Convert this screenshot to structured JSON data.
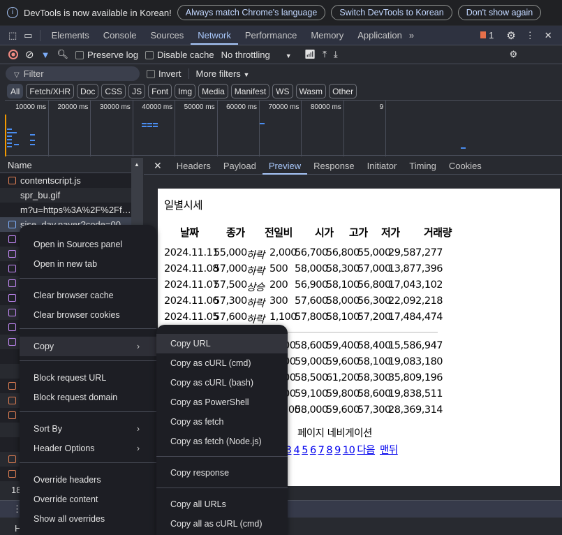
{
  "infobar": {
    "message": "DevTools is now available in Korean!",
    "buttons": [
      "Always match Chrome's language",
      "Switch DevTools to Korean",
      "Don't show again"
    ]
  },
  "tabs": [
    "Elements",
    "Console",
    "Sources",
    "Network",
    "Performance",
    "Memory",
    "Application"
  ],
  "active_tab": "Network",
  "issues_count": "1",
  "toolbar": {
    "preserve_log": "Preserve log",
    "disable_cache": "Disable cache",
    "throttling": "No throttling"
  },
  "filter": {
    "placeholder": "Filter",
    "invert": "Invert",
    "more_filters": "More filters"
  },
  "type_chips": [
    "All",
    "Fetch/XHR",
    "Doc",
    "CSS",
    "JS",
    "Font",
    "Img",
    "Media",
    "Manifest",
    "WS",
    "Wasm",
    "Other"
  ],
  "timeline_ticks": [
    "10000 ms",
    "20000 ms",
    "30000 ms",
    "40000 ms",
    "50000 ms",
    "60000 ms",
    "70000 ms",
    "80000 ms",
    "9"
  ],
  "request_list": {
    "header": "Name",
    "items": [
      "contentscript.js",
      "spr_bu.gif",
      "m?u=https%3A%2F%2Ffina...",
      "sise_day.naver?code=0059..."
    ],
    "footer_count": "18",
    "bottom_letter": "H"
  },
  "detail_tabs": [
    "Headers",
    "Payload",
    "Preview",
    "Response",
    "Initiator",
    "Timing",
    "Cookies"
  ],
  "active_detail_tab": "Preview",
  "preview": {
    "title": "일별시세",
    "headers": [
      "날짜",
      "종가",
      "전일비",
      "시가",
      "고가",
      "저가",
      "거래량"
    ],
    "rows": [
      [
        "2024.11.11",
        "55,000",
        "하락",
        "2,000",
        "56,700",
        "56,800",
        "55,000",
        "29,587,277"
      ],
      [
        "2024.11.08",
        "57,000",
        "하락",
        "500",
        "58,000",
        "58,300",
        "57,000",
        "13,877,396"
      ],
      [
        "2024.11.07",
        "57,500",
        "상승",
        "200",
        "56,900",
        "58,100",
        "56,800",
        "17,043,102"
      ],
      [
        "2024.11.06",
        "57,300",
        "하락",
        "300",
        "57,600",
        "58,000",
        "56,300",
        "22,092,218"
      ],
      [
        "2024.11.05",
        "57,600",
        "하락",
        "1,100",
        "57,800",
        "58,100",
        "57,200",
        "17,484,474"
      ]
    ],
    "rows_partial": [
      [
        "00",
        "58,600",
        "59,400",
        "58,400",
        "15,586,947"
      ],
      [
        "00",
        "59,000",
        "59,600",
        "58,100",
        "19,083,180"
      ],
      [
        "00",
        "58,500",
        "61,200",
        "58,300",
        "35,809,196"
      ],
      [
        "00",
        "59,100",
        "59,800",
        "58,600",
        "19,838,511"
      ],
      [
        ",500",
        "58,000",
        "59,600",
        "57,300",
        "28,369,314"
      ]
    ],
    "nav_label": "페이지 네비게이션",
    "nav_links": [
      "2",
      "3",
      "4",
      "5",
      "6",
      "7",
      "8",
      "9",
      "10",
      "다음",
      "맨뒤"
    ]
  },
  "context_menu": [
    "Open in Sources panel",
    "Open in new tab",
    "Clear browser cache",
    "Clear browser cookies",
    "Copy",
    "Block request URL",
    "Block request domain",
    "Sort By",
    "Header Options",
    "Override headers",
    "Override content",
    "Show all overrides"
  ],
  "copy_submenu": [
    "Copy URL",
    "Copy as cURL (cmd)",
    "Copy as cURL (bash)",
    "Copy as PowerShell",
    "Copy as fetch",
    "Copy as fetch (Node.js)",
    "Copy response",
    "Copy all URLs",
    "Copy all as cURL (cmd)"
  ]
}
